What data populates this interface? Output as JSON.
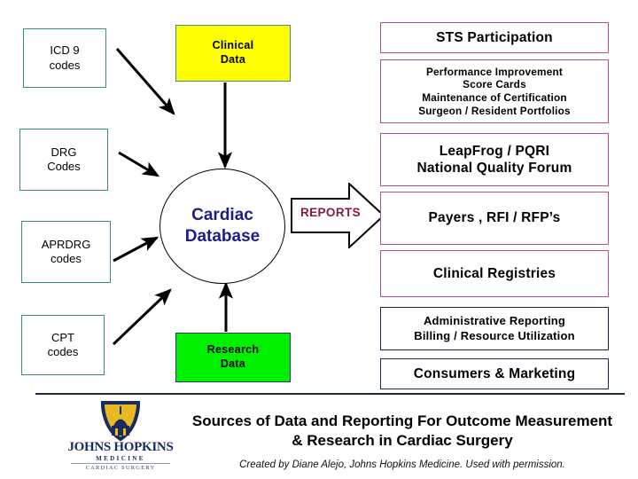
{
  "diagram": {
    "title": "Sources of Data and Reporting For Outcome Measurement & Research in Cardiac Surgery",
    "credit": "Created by Diane Alejo, Johns Hopkins Medicine. Used with permission."
  },
  "colors": {
    "yellow_fill": "#ffff00",
    "green_fill": "#00f000",
    "teal_border": "#3a8a92",
    "pink_border": "#b5539a",
    "navy_border": "#1f2a50",
    "circle_text": "#1c1c8c",
    "reports_text": "#8b1a3a",
    "logo_navy": "#1b2a5e",
    "logo_gold": "#e8b923"
  },
  "code_sources": [
    {
      "id": "icd9",
      "line1": "ICD 9",
      "line2": "codes"
    },
    {
      "id": "drg",
      "line1": "DRG",
      "line2": "Codes"
    },
    {
      "id": "aprdrg",
      "line1": "APRDRG",
      "line2": "codes"
    },
    {
      "id": "cpt",
      "line1": "CPT",
      "line2": "codes"
    }
  ],
  "data_sources": [
    {
      "id": "clinical",
      "line1": "Clinical",
      "line2": "Data"
    },
    {
      "id": "research",
      "line1": "Research",
      "line2": "Data"
    }
  ],
  "central": {
    "line1": "Cardiac",
    "line2": "Database"
  },
  "reports_arrow": {
    "label": "REPORTS"
  },
  "outputs": [
    {
      "id": "sts",
      "lines": [
        "STS Participation"
      ],
      "style": "pink",
      "size": "lg"
    },
    {
      "id": "performance",
      "lines": [
        "Performance Improvement",
        "Score Cards",
        "Maintenance of Certification",
        "Surgeon / Resident Portfolios"
      ],
      "style": "pink",
      "size": "sm"
    },
    {
      "id": "leapfrog",
      "lines": [
        "LeapFrog / PQRI",
        "National Quality Forum"
      ],
      "style": "pink",
      "size": "lg"
    },
    {
      "id": "payers",
      "lines": [
        "Payers , RFI / RFP’s"
      ],
      "style": "pink",
      "size": "lg"
    },
    {
      "id": "registries",
      "lines": [
        "Clinical Registries"
      ],
      "style": "pink",
      "size": "lg"
    },
    {
      "id": "administrative",
      "lines": [
        "Administrative Reporting",
        "Billing / Resource Utilization"
      ],
      "style": "navy",
      "size": "md"
    },
    {
      "id": "consumers",
      "lines": [
        "Consumers & Marketing"
      ],
      "style": "navy",
      "size": "lg"
    }
  ],
  "logo": {
    "wordmark": "JOHNS HOPKINS",
    "subtitle": "MEDICINE",
    "department": "CARDIAC SURGERY"
  }
}
